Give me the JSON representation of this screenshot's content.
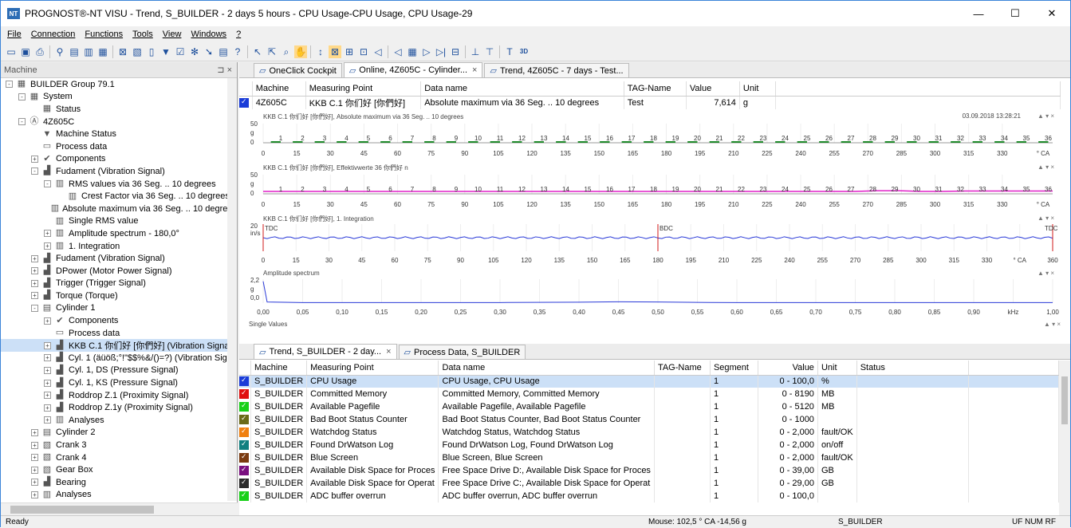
{
  "window": {
    "title": "PROGNOST®-NT VISU - Trend, S_BUILDER - 2 days 5 hours - CPU Usage-CPU Usage, CPU Usage-29",
    "app_icon": "NT"
  },
  "menu": [
    "File",
    "Connection",
    "Functions",
    "Tools",
    "View",
    "Windows",
    "?"
  ],
  "left_panel": {
    "title": "Machine",
    "pin": "⊐ ×",
    "tree": [
      {
        "label": "BUILDER Group 79.1",
        "level": 0,
        "exp": "-",
        "icon": "group-icon",
        "glyph": "▦"
      },
      {
        "label": "System",
        "level": 1,
        "exp": "-",
        "icon": "system-icon",
        "glyph": "▦"
      },
      {
        "label": "Status",
        "level": 2,
        "exp": "",
        "icon": "status-icon",
        "glyph": "▦"
      },
      {
        "label": "4Z605C",
        "level": 1,
        "exp": "-",
        "icon": "machine-icon",
        "glyph": "Ⓐ"
      },
      {
        "label": "Machine Status",
        "level": 2,
        "exp": "",
        "icon": "machine-status-icon",
        "glyph": "▼"
      },
      {
        "label": "Process data",
        "level": 2,
        "exp": "",
        "icon": "process-data-icon",
        "glyph": "▭"
      },
      {
        "label": "Components",
        "level": 2,
        "exp": "+",
        "icon": "wrench-icon",
        "glyph": "✔"
      },
      {
        "label": "Fudament (Vibration Signal)",
        "level": 2,
        "exp": "-",
        "icon": "signal-icon",
        "glyph": "▟"
      },
      {
        "label": "RMS values via 36 Seg. .. 10 degrees",
        "level": 3,
        "exp": "-",
        "icon": "analysis-icon",
        "glyph": "▥"
      },
      {
        "label": "Crest Factor via 36 Seg. .. 10 degrees",
        "level": 4,
        "exp": "",
        "icon": "analysis-icon",
        "glyph": "▥"
      },
      {
        "label": "Absolute maximum via 36 Seg. .. 10 degrees",
        "level": 3,
        "exp": "",
        "icon": "analysis-icon",
        "glyph": "▥"
      },
      {
        "label": "Single RMS value",
        "level": 3,
        "exp": "",
        "icon": "analysis-icon",
        "glyph": "▥"
      },
      {
        "label": "Amplitude spectrum - 180,0°",
        "level": 3,
        "exp": "+",
        "icon": "spectrum-icon",
        "glyph": "▥"
      },
      {
        "label": "1. Integration",
        "level": 3,
        "exp": "+",
        "icon": "integration-icon",
        "glyph": "▥"
      },
      {
        "label": "Fudament (Vibration Signal)",
        "level": 2,
        "exp": "+",
        "icon": "signal-icon",
        "glyph": "▟"
      },
      {
        "label": "DPower (Motor Power Signal)",
        "level": 2,
        "exp": "+",
        "icon": "signal-icon",
        "glyph": "▟"
      },
      {
        "label": "Trigger (Trigger Signal)",
        "level": 2,
        "exp": "+",
        "icon": "signal-icon",
        "glyph": "▟"
      },
      {
        "label": "Torque (Torque)",
        "level": 2,
        "exp": "+",
        "icon": "signal-icon",
        "glyph": "▟"
      },
      {
        "label": "Cylinder 1",
        "level": 2,
        "exp": "-",
        "icon": "cylinder-icon",
        "glyph": "▤"
      },
      {
        "label": "Components",
        "level": 3,
        "exp": "+",
        "icon": "wrench-icon",
        "glyph": "✔"
      },
      {
        "label": "Process data",
        "level": 3,
        "exp": "",
        "icon": "process-data-icon",
        "glyph": "▭"
      },
      {
        "label": "KKB C.1 你们好 [你們好] (Vibration Signal)",
        "level": 3,
        "exp": "+",
        "icon": "signal-icon",
        "glyph": "▟",
        "selected": true
      },
      {
        "label": "Cyl. 1 (äüöß;°!\"$$%&/()=?) (Vibration Signa",
        "level": 3,
        "exp": "+",
        "icon": "signal-icon",
        "glyph": "▟"
      },
      {
        "label": "Cyl. 1, DS (Pressure Signal)",
        "level": 3,
        "exp": "+",
        "icon": "signal-icon",
        "glyph": "▟"
      },
      {
        "label": "Cyl. 1, KS (Pressure Signal)",
        "level": 3,
        "exp": "+",
        "icon": "signal-icon",
        "glyph": "▟"
      },
      {
        "label": "Roddrop Z.1 (Proximity Signal)",
        "level": 3,
        "exp": "+",
        "icon": "signal-icon",
        "glyph": "▟"
      },
      {
        "label": "Roddrop Z.1y (Proximity Signal)",
        "level": 3,
        "exp": "+",
        "icon": "signal-icon",
        "glyph": "▟"
      },
      {
        "label": "Analyses",
        "level": 3,
        "exp": "+",
        "icon": "analyses-icon",
        "glyph": "▥"
      },
      {
        "label": "Cylinder 2",
        "level": 2,
        "exp": "+",
        "icon": "cylinder-icon",
        "glyph": "▤"
      },
      {
        "label": "Crank 3",
        "level": 2,
        "exp": "+",
        "icon": "crank-icon",
        "glyph": "▧"
      },
      {
        "label": "Crank 4",
        "level": 2,
        "exp": "+",
        "icon": "crank-icon",
        "glyph": "▧"
      },
      {
        "label": "Gear Box",
        "level": 2,
        "exp": "+",
        "icon": "gearbox-icon",
        "glyph": "▧"
      },
      {
        "label": "Bearing",
        "level": 2,
        "exp": "+",
        "icon": "bearing-icon",
        "glyph": "▟"
      },
      {
        "label": "Analyses",
        "level": 2,
        "exp": "+",
        "icon": "analyses-icon",
        "glyph": "▥"
      },
      {
        "label": "2Z605C",
        "level": 1,
        "exp": "-",
        "icon": "machine-icon",
        "glyph": "Ⓐ"
      }
    ]
  },
  "top_tabs": [
    {
      "label": "OneClick Cockpit",
      "icon": "cockpit-icon",
      "close": ""
    },
    {
      "label": "Online, 4Z605C - Cylinder...",
      "icon": "online-icon",
      "close": "×"
    },
    {
      "label": "Trend, 4Z605C - 7 days - Test...",
      "icon": "trend-icon",
      "close": ""
    }
  ],
  "top_table": {
    "headers": [
      "Machine",
      "Measuring Point",
      "Data name",
      "TAG-Name",
      "Value",
      "Unit"
    ],
    "row": {
      "machine": "4Z605C",
      "point": "KKB C.1 你们好 [你們好]",
      "data": "Absolute maximum via 36 Seg. .. 10 degrees",
      "tag": "Test",
      "value": "7,614",
      "unit": "g",
      "color": "#1a3cd8"
    }
  },
  "charts": {
    "c1": {
      "title": "KKB C.1 你们好 [你們好], Absolute maximum via 36 Seg. .. 10 degrees",
      "time": "03.09.2018 13:28:21",
      "y": [
        "50",
        "g",
        "0"
      ],
      "unit": "° CA"
    },
    "c2": {
      "title": "KKB C.1 你们好 [你們好], Effektivwerte 36 你們好 n",
      "y": [
        "50",
        "g",
        "0"
      ],
      "unit": "° CA"
    },
    "c3": {
      "title": "KKB C.1 你们好 [你們好], 1. Integration",
      "y": [
        "20",
        "in/s"
      ],
      "markers": [
        "TDC",
        "BDC",
        "TDC"
      ],
      "unit": "° CA"
    },
    "c4": {
      "title": "Amplitude spectrum",
      "y": [
        "2,2",
        "g",
        "0,0"
      ],
      "unit": "kHz"
    },
    "single_values": "Single Values",
    "ctrl": "▲ ▾ ×"
  },
  "chart_data": [
    {
      "type": "bar",
      "title": "KKB C.1 你们好 [你們好], Absolute maximum via 36 Seg. .. 10 degrees",
      "xlabel": "° CA",
      "ylabel": "g",
      "ylim": [
        0,
        50
      ],
      "categories": [
        "1",
        "2",
        "3",
        "4",
        "5",
        "6",
        "7",
        "8",
        "9",
        "10",
        "11",
        "12",
        "13",
        "14",
        "15",
        "16",
        "17",
        "18",
        "19",
        "20",
        "21",
        "22",
        "23",
        "24",
        "25",
        "26",
        "27",
        "28",
        "29",
        "30",
        "31",
        "32",
        "33",
        "34",
        "35",
        "36"
      ],
      "values": [
        3,
        2,
        2,
        2,
        2,
        2,
        2,
        2,
        2,
        2,
        2,
        2,
        2,
        2,
        2,
        2,
        2,
        2,
        2,
        2,
        2,
        2,
        2,
        2,
        2,
        2,
        2,
        2,
        3,
        3,
        2,
        4,
        3,
        3,
        2,
        2
      ],
      "x_ticks": [
        "0",
        "15",
        "30",
        "45",
        "60",
        "75",
        "90",
        "105",
        "120",
        "135",
        "150",
        "165",
        "180",
        "195",
        "210",
        "225",
        "240",
        "255",
        "270",
        "285",
        "300",
        "315",
        "330"
      ]
    },
    {
      "type": "line",
      "title": "KKB C.1 你们好 [你們好], Effektivwerte 36 你們好 n",
      "xlabel": "° CA",
      "ylabel": "g",
      "ylim": [
        0,
        50
      ],
      "x": [
        0,
        10,
        20,
        30,
        40,
        50,
        60,
        70,
        80,
        90,
        100,
        110,
        120,
        130,
        140,
        150,
        160,
        170,
        180,
        190,
        200,
        210,
        220,
        230,
        240,
        250,
        260,
        270,
        280,
        290,
        300,
        310,
        320,
        330,
        340,
        350,
        360
      ],
      "y": [
        2,
        2,
        2,
        2,
        2,
        2,
        2,
        2,
        2,
        2,
        2,
        2,
        2,
        2,
        2,
        2,
        2,
        2,
        2,
        2,
        2,
        2,
        2,
        2,
        2,
        2,
        2,
        2,
        4,
        4,
        2,
        2,
        3,
        3,
        3,
        3,
        3
      ],
      "x_ticks": [
        "0",
        "15",
        "30",
        "45",
        "60",
        "75",
        "90",
        "105",
        "120",
        "135",
        "150",
        "165",
        "180",
        "195",
        "210",
        "225",
        "240",
        "255",
        "270",
        "285",
        "300",
        "315",
        "330"
      ]
    },
    {
      "type": "line",
      "title": "KKB C.1 你们好 [你們好], 1. Integration",
      "xlabel": "° CA",
      "ylabel": "in/s",
      "ylim": [
        -20,
        20
      ],
      "x": [
        0,
        30,
        60,
        90,
        120,
        150,
        180,
        210,
        240,
        270,
        300,
        330,
        360
      ],
      "y": [
        0,
        0,
        0,
        0,
        0,
        0,
        0,
        0,
        0,
        0,
        0,
        0,
        0
      ],
      "x_ticks": [
        "0",
        "15",
        "30",
        "45",
        "60",
        "75",
        "90",
        "105",
        "120",
        "135",
        "150",
        "165",
        "180",
        "195",
        "210",
        "225",
        "240",
        "255",
        "270",
        "285",
        "300",
        "315",
        "330",
        "° CA",
        "360"
      ]
    },
    {
      "type": "line",
      "title": "Amplitude spectrum",
      "xlabel": "kHz",
      "ylabel": "g",
      "ylim": [
        0,
        2.2
      ],
      "x": [
        0,
        0.005,
        0.05,
        0.1,
        0.2,
        0.3,
        0.4,
        0.45,
        0.5,
        0.55,
        0.6,
        0.7,
        0.8,
        0.9,
        1.0
      ],
      "y": [
        2.0,
        0.1,
        0.05,
        0.05,
        0.05,
        0.05,
        0.08,
        0.12,
        0.1,
        0.06,
        0.05,
        0.05,
        0.05,
        0.05,
        0.05
      ],
      "x_ticks": [
        "0,00",
        "0,05",
        "0,10",
        "0,15",
        "0,20",
        "0,25",
        "0,30",
        "0,35",
        "0,40",
        "0,45",
        "0,50",
        "0,55",
        "0,60",
        "0,65",
        "0,70",
        "0,75",
        "0,80",
        "0,85",
        "0,90",
        "kHz",
        "1,00"
      ]
    }
  ],
  "bottom_tabs": [
    {
      "label": "Trend, S_BUILDER - 2 day...",
      "icon": "trend-icon",
      "close": "×"
    },
    {
      "label": "Process Data, S_BUILDER",
      "icon": "process-data-icon",
      "close": ""
    }
  ],
  "bottom_table": {
    "headers": [
      "Machine",
      "Measuring Point",
      "Data name",
      "TAG-Name",
      "Segment",
      "Value",
      "Unit",
      "Status"
    ],
    "rows": [
      {
        "color": "#1a3cd8",
        "machine": "S_BUILDER",
        "point": "CPU Usage",
        "data": "CPU Usage, CPU Usage",
        "seg": "1",
        "value": "0 - 100,0",
        "unit": "%"
      },
      {
        "color": "#e01010",
        "machine": "S_BUILDER",
        "point": "Committed Memory",
        "data": "Committed Memory, Committed Memory",
        "seg": "1",
        "value": "0 - 8190",
        "unit": "MB"
      },
      {
        "color": "#18d018",
        "machine": "S_BUILDER",
        "point": "Available Pagefile",
        "data": "Available Pagefile, Available Pagefile",
        "seg": "1",
        "value": "0 - 5120",
        "unit": "MB"
      },
      {
        "color": "#6a6a18",
        "machine": "S_BUILDER",
        "point": "Bad Boot Status Counter",
        "data": "Bad Boot Status Counter, Bad Boot Status Counter",
        "seg": "1",
        "value": "0 - 1000",
        "unit": ""
      },
      {
        "color": "#f08010",
        "machine": "S_BUILDER",
        "point": "Watchdog Status",
        "data": "Watchdog Status, Watchdog Status",
        "seg": "1",
        "value": "0 - 2,000",
        "unit": "fault/OK"
      },
      {
        "color": "#108080",
        "machine": "S_BUILDER",
        "point": "Found DrWatson Log",
        "data": "Found DrWatson Log, Found DrWatson Log",
        "seg": "1",
        "value": "0 - 2,000",
        "unit": "on/off"
      },
      {
        "color": "#7a3a10",
        "machine": "S_BUILDER",
        "point": "Blue Screen",
        "data": "Blue Screen, Blue Screen",
        "seg": "1",
        "value": "0 - 2,000",
        "unit": "fault/OK"
      },
      {
        "color": "#7a1080",
        "machine": "S_BUILDER",
        "point": "Available Disk Space for Proces",
        "data": "Free Space Drive D:, Available Disk Space for Proces",
        "seg": "1",
        "value": "0 - 39,00",
        "unit": "GB"
      },
      {
        "color": "#2a2a2a",
        "machine": "S_BUILDER",
        "point": "Available Disk Space for Operat",
        "data": "Free Space Drive C:, Available Disk Space for Operat",
        "seg": "1",
        "value": "0 - 29,00",
        "unit": "GB"
      },
      {
        "color": "#18d018",
        "machine": "S_BUILDER",
        "point": "ADC buffer overrun",
        "data": "ADC buffer overrun, ADC buffer overrun",
        "seg": "1",
        "value": "0 - 100,0",
        "unit": ""
      }
    ]
  },
  "status": {
    "ready": "Ready",
    "mouse": "Mouse: 102,5 ° CA  -14,56 g",
    "machine": "S_BUILDER",
    "keys": "UF NUM RF"
  }
}
